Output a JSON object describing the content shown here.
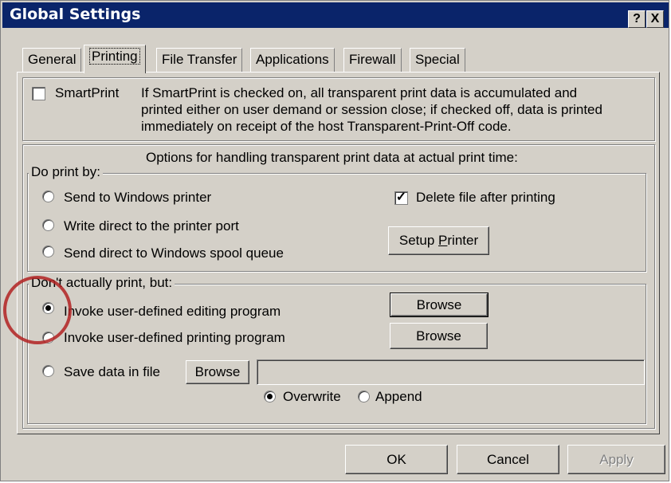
{
  "window": {
    "title": "Global Settings",
    "help_label": "?",
    "close_label": "X"
  },
  "tabs": [
    "General",
    "Printing",
    "File Transfer",
    "Applications",
    "Firewall",
    "Special"
  ],
  "smartprint": {
    "label": "SmartPrint",
    "checked": false,
    "desc_line1": "If SmartPrint is checked on, all transparent print data is accumulated and",
    "desc_line2": "printed either on user demand or session close;  if checked off, data is printed",
    "desc_line3": "immediately on receipt of the host Transparent-Print-Off code."
  },
  "options_heading": "Options for handling transparent print data at actual print time:",
  "do_print": {
    "legend": "Do print by:",
    "options": [
      "Send to Windows printer",
      "Write direct to the printer port",
      "Send direct to Windows spool queue"
    ],
    "delete_label": "Delete file after printing",
    "delete_checked": true,
    "setup_printer_pre": "Setup ",
    "setup_printer_key": "P",
    "setup_printer_post": "rinter"
  },
  "dont_print": {
    "legend": "Don't actually print, but:",
    "invoke_edit": "Invoke user-defined editing program",
    "invoke_print": "Invoke user-defined printing program",
    "save_file": "Save data in file",
    "browse_label": "Browse",
    "file_value": "",
    "overwrite_label": "Overwrite",
    "append_label": "Append",
    "selected": "invoke_edit",
    "write_mode": "overwrite"
  },
  "footer": {
    "ok": "OK",
    "cancel": "Cancel",
    "apply": "Apply"
  },
  "colors": {
    "titlebar": "#0a246a",
    "face": "#d4d0c8",
    "highlight_circle": "#b22222"
  }
}
